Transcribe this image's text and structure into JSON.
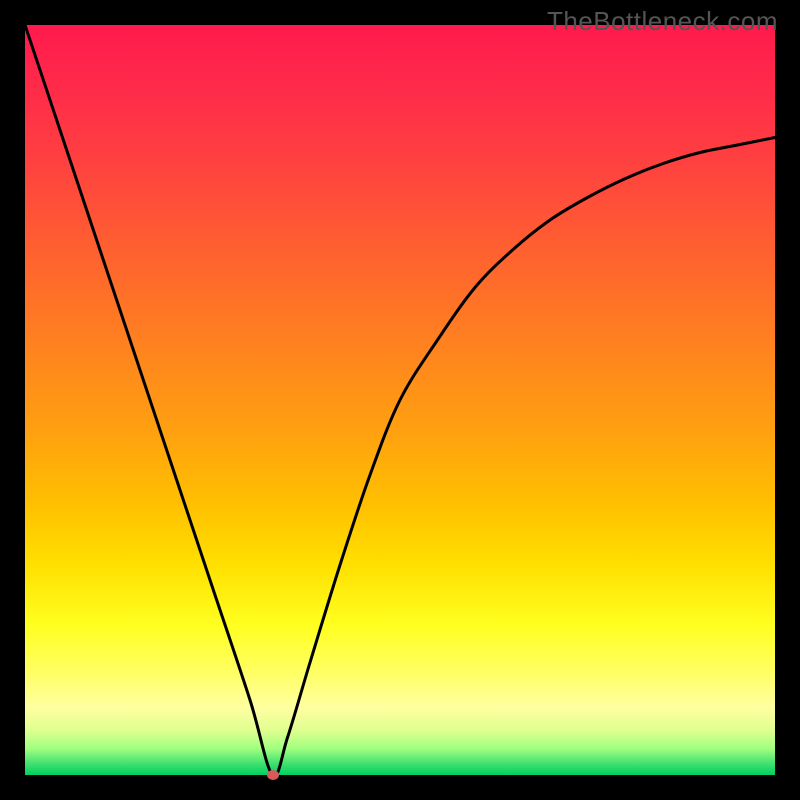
{
  "watermark": "TheBottleneck.com",
  "chart_data": {
    "type": "line",
    "title": "",
    "xlabel": "",
    "ylabel": "",
    "xlim": [
      0,
      100
    ],
    "ylim": [
      0,
      100
    ],
    "series": [
      {
        "name": "bottleneck-curve",
        "x": [
          0,
          5,
          10,
          15,
          20,
          25,
          30,
          33,
          35,
          38,
          42,
          46,
          50,
          55,
          60,
          65,
          70,
          75,
          80,
          85,
          90,
          95,
          100
        ],
        "values": [
          100,
          85,
          70,
          55,
          40,
          25,
          10,
          0,
          5,
          15,
          28,
          40,
          50,
          58,
          65,
          70,
          74,
          77,
          79.5,
          81.5,
          83,
          84,
          85
        ]
      }
    ],
    "marker": {
      "x": 33,
      "y": 0,
      "color": "#d85a5a"
    },
    "gradient_stops": [
      {
        "pos": 0,
        "color": "#ff1a4d"
      },
      {
        "pos": 50,
        "color": "#ffa010"
      },
      {
        "pos": 80,
        "color": "#ffff20"
      },
      {
        "pos": 100,
        "color": "#00d060"
      }
    ]
  }
}
